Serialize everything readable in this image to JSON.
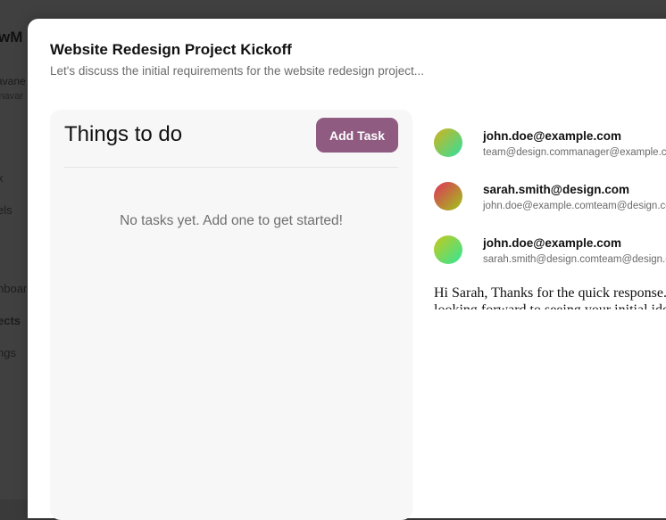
{
  "background": {
    "brand": "wM",
    "user_name": "avane",
    "user_sub": "inavar",
    "nav": [
      "x",
      "els",
      "nboar",
      "ects",
      "ngs"
    ]
  },
  "modal": {
    "title": "Website Redesign Project Kickoff",
    "subtitle": "Let's discuss the initial requirements for the website redesign project..."
  },
  "tasks": {
    "title": "Things to do",
    "add_label": "Add Task",
    "empty_message": "No tasks yet. Add one to get started!"
  },
  "thread": {
    "messages": [
      {
        "sender": "john.doe@example.com",
        "recipients": "team@design.commanager@example.com",
        "avatar_colors": [
          "#d4b21a",
          "#2fe0a0"
        ]
      },
      {
        "sender": "sarah.smith@design.com",
        "recipients": "john.doe@example.comteam@design.com",
        "avatar_colors": [
          "#e0305a",
          "#9ec81a"
        ]
      },
      {
        "sender": "john.doe@example.com",
        "recipients": "sarah.smith@design.comteam@design.com",
        "avatar_colors": [
          "#c9c81a",
          "#2fe79a"
        ]
      }
    ],
    "body_line1": "Hi Sarah, Thanks for the quick response. I'm",
    "body_line2": "looking forward to seeing your initial ideas."
  },
  "colors": {
    "accent": "#8f5b81",
    "panel_bg": "#f8f7f8"
  }
}
